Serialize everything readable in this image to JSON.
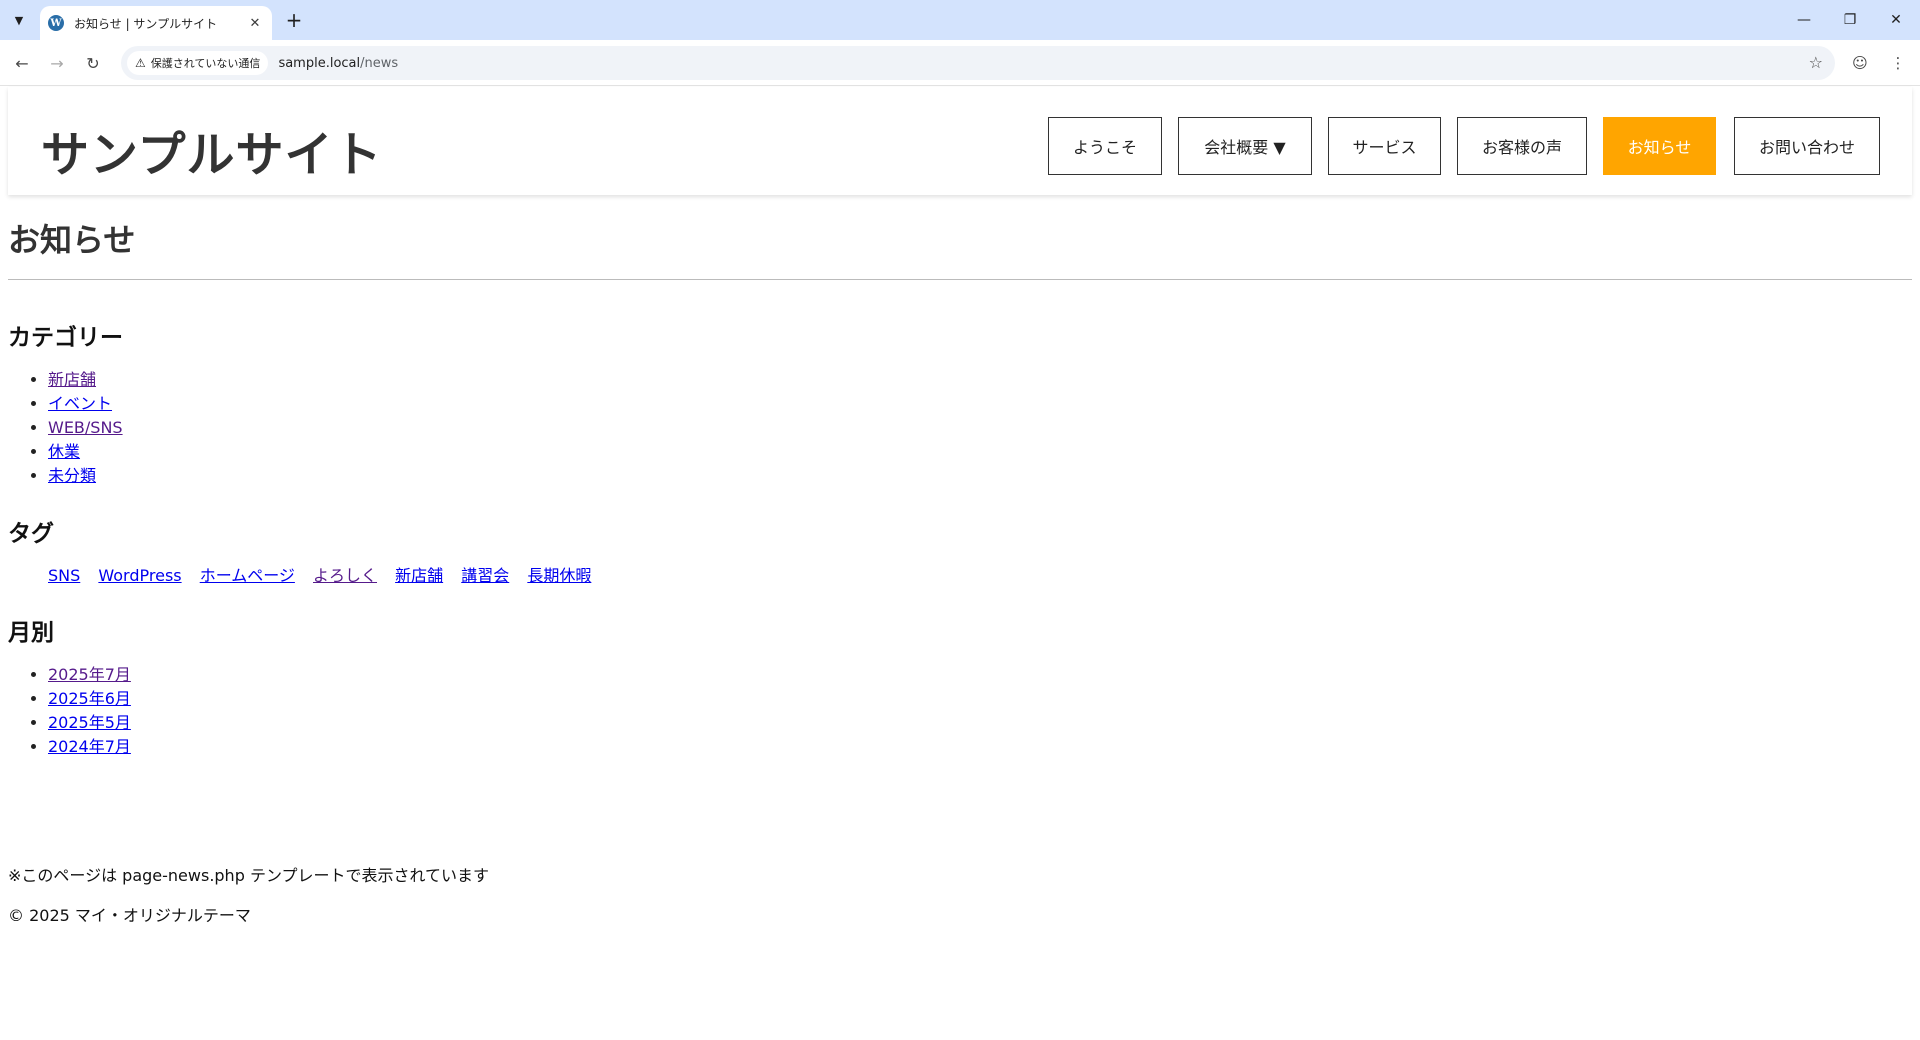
{
  "browser": {
    "tab_title": "お知らせ | サンプルサイト",
    "security_label": "保護されていない通信",
    "url_host": "sample.local",
    "url_path": "/news"
  },
  "site": {
    "title": "サンプルサイト",
    "nav": [
      {
        "label": "ようこそ"
      },
      {
        "label": "会社概要 ▼"
      },
      {
        "label": "サービス"
      },
      {
        "label": "お客様の声"
      },
      {
        "label": "お知らせ",
        "active": true
      },
      {
        "label": "お問い合わせ"
      }
    ],
    "accent_color": "#ffa500"
  },
  "page": {
    "heading": "お知らせ",
    "categories": {
      "title": "カテゴリー",
      "items": [
        "新店舗",
        "イベント",
        "WEB/SNS",
        "休業",
        "未分類"
      ]
    },
    "tags": {
      "title": "タグ",
      "items": [
        "SNS",
        "WordPress",
        "ホームページ",
        "よろしく",
        "新店舗",
        "講習会",
        "長期休暇"
      ]
    },
    "monthly": {
      "title": "月別",
      "items": [
        "2025年7月",
        "2025年6月",
        "2025年5月",
        "2024年7月"
      ]
    },
    "note": "※このページは page-news.php テンプレートで表示されています",
    "copyright": "© 2025 マイ・オリジナルテーマ"
  }
}
